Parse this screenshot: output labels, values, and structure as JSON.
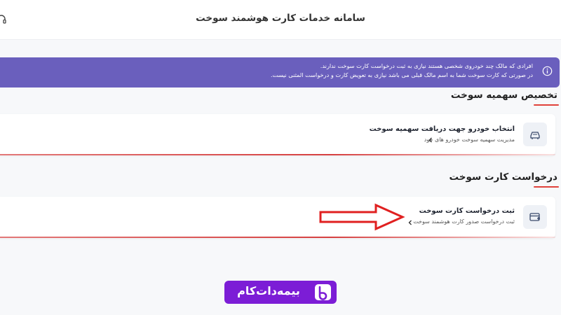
{
  "header": {
    "title": "سامانه خدمات کارت هوشمند سوخت",
    "support_icon": "headset-icon"
  },
  "alert": {
    "icon": "info-icon",
    "line1": "افرادی که مالک چند خودروی شخصی هستند نیازی به ثبت درخواست کارت سوخت ندارند.",
    "line2": "در صورتی که کارت سوخت شما به اسم مالک قبلی می باشد نیازی به تعویض کارت و درخواست المثنی نیست."
  },
  "sections": [
    {
      "title": "تخصیص سهمیه سوخت",
      "card": {
        "icon": "car-fuel-icon",
        "title": "انتخاب خودرو جهت دریافت سهمیه سوخت",
        "subtitle": "مدیریت سهمیه سوخت خودرو های خود"
      }
    },
    {
      "title": "درخواست کارت سوخت",
      "card": {
        "icon": "card-add-icon",
        "title": "ثبت درخواست کارت سوخت",
        "subtitle": "ثبت درخواست صدور کارت هوشمند سوخت"
      }
    }
  ],
  "annotation": {
    "arrow_color": "#e02020"
  },
  "brand": {
    "text": "بیمه‌دات‌کام",
    "color": "#7c1dd6"
  },
  "colors": {
    "alert_bg": "#6a5fbd",
    "accent_red": "#e0413a"
  }
}
